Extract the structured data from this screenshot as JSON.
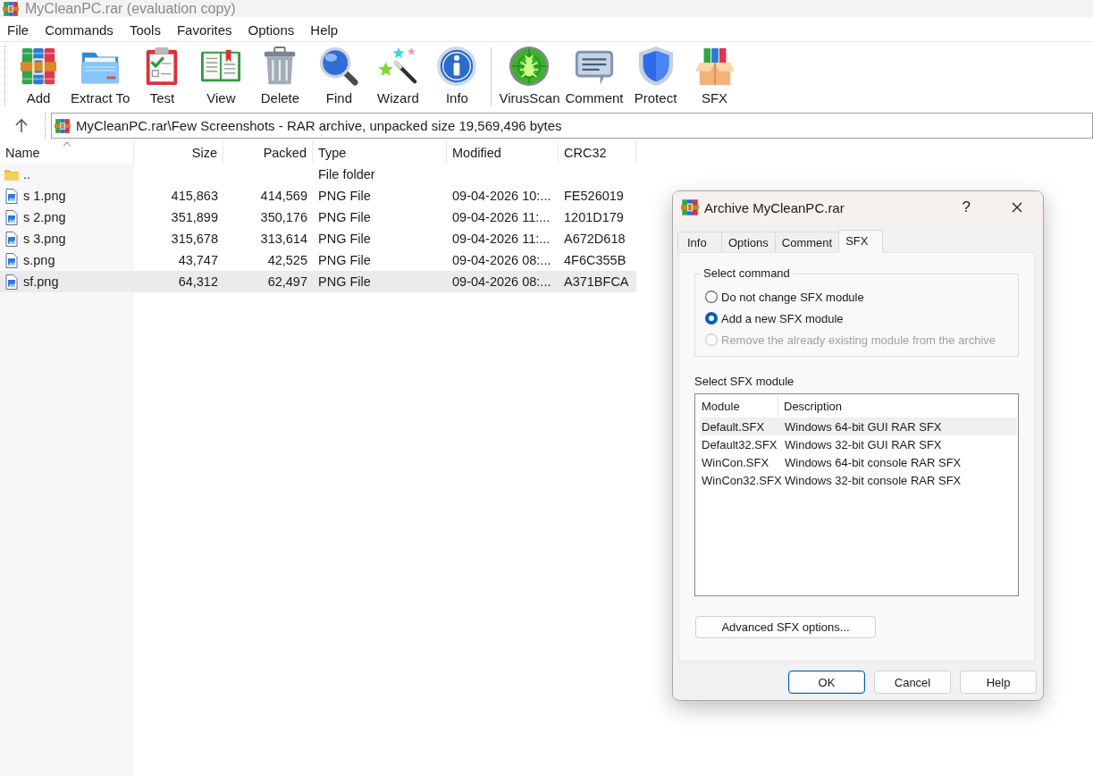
{
  "window": {
    "title": "MyCleanPC.rar (evaluation copy)"
  },
  "menu": [
    "File",
    "Commands",
    "Tools",
    "Favorites",
    "Options",
    "Help"
  ],
  "toolbar": {
    "groups": [
      [
        {
          "kind": "add",
          "label": "Add"
        },
        {
          "kind": "extract",
          "label": "Extract To"
        },
        {
          "kind": "test",
          "label": "Test"
        },
        {
          "kind": "view",
          "label": "View"
        },
        {
          "kind": "delete",
          "label": "Delete"
        },
        {
          "kind": "find",
          "label": "Find"
        },
        {
          "kind": "wizard",
          "label": "Wizard"
        },
        {
          "kind": "info",
          "label": "Info"
        }
      ],
      [
        {
          "kind": "scan",
          "label": "VirusScan"
        },
        {
          "kind": "comment",
          "label": "Comment"
        },
        {
          "kind": "protect",
          "label": "Protect"
        },
        {
          "kind": "sfx",
          "label": "SFX"
        }
      ]
    ]
  },
  "address_bar": {
    "path": "MyCleanPC.rar\\Few Screenshots - RAR archive, unpacked size 19,569,496 bytes"
  },
  "file_list": {
    "columns": [
      {
        "label": "Name",
        "sorted": true
      },
      {
        "label": "Size",
        "sorted": false
      },
      {
        "label": "Packed",
        "sorted": false
      },
      {
        "label": "Type",
        "sorted": false
      },
      {
        "label": "Modified",
        "sorted": false
      },
      {
        "label": "CRC32",
        "sorted": false
      }
    ],
    "rows": [
      {
        "kind": "folder",
        "name": "..",
        "type": "File folder",
        "selected": false
      },
      {
        "kind": "file",
        "name": "s 1.png",
        "size": "415,863",
        "packed": "414,569",
        "type": "PNG File",
        "modified": "09-04-2026 10:...",
        "crc32": "FE526019",
        "selected": false
      },
      {
        "kind": "file",
        "name": "s 2.png",
        "size": "351,899",
        "packed": "350,176",
        "type": "PNG File",
        "modified": "09-04-2026 11:...",
        "crc32": "1201D179",
        "selected": false
      },
      {
        "kind": "file",
        "name": "s 3.png",
        "size": "315,678",
        "packed": "313,614",
        "type": "PNG File",
        "modified": "09-04-2026 11:...",
        "crc32": "A672D618",
        "selected": false
      },
      {
        "kind": "file",
        "name": "s.png",
        "size": "43,747",
        "packed": "42,525",
        "type": "PNG File",
        "modified": "09-04-2026 08:...",
        "crc32": "4F6C355B",
        "selected": false
      },
      {
        "kind": "file",
        "name": "sf.png",
        "size": "64,312",
        "packed": "62,497",
        "type": "PNG File",
        "modified": "09-04-2026 08:...",
        "crc32": "A371BFCA",
        "selected": true
      }
    ]
  },
  "dialog": {
    "title": "Archive MyCleanPC.rar",
    "help": "?",
    "tabs": [
      {
        "label": "Info",
        "selected": false
      },
      {
        "label": "Options",
        "selected": false
      },
      {
        "label": "Comment",
        "selected": false
      },
      {
        "label": "SFX",
        "selected": true
      }
    ],
    "command_group": {
      "title": "Select command",
      "options": [
        {
          "label": "Do not change SFX module",
          "selected": false,
          "disabled": false
        },
        {
          "label": "Add a new SFX module",
          "selected": true,
          "disabled": false
        },
        {
          "label": "Remove the already existing module from the archive",
          "selected": false,
          "disabled": true
        }
      ]
    },
    "module_label": "Select SFX module",
    "module_list": {
      "columns": [
        "Module",
        "Description"
      ],
      "rows": [
        {
          "module": "Default.SFX",
          "description": "Windows 64-bit GUI RAR SFX",
          "selected": true
        },
        {
          "module": "Default32.SFX",
          "description": "Windows 32-bit GUI RAR SFX",
          "selected": false
        },
        {
          "module": "WinCon.SFX",
          "description": "Windows 64-bit console RAR SFX",
          "selected": false
        },
        {
          "module": "WinCon32.SFX",
          "description": "Windows 32-bit console RAR SFX",
          "selected": false
        }
      ]
    },
    "advanced_button": "Advanced SFX options...",
    "buttons": [
      {
        "label": "OK",
        "default": true
      },
      {
        "label": "Cancel",
        "default": false
      },
      {
        "label": "Help",
        "default": false
      }
    ]
  }
}
